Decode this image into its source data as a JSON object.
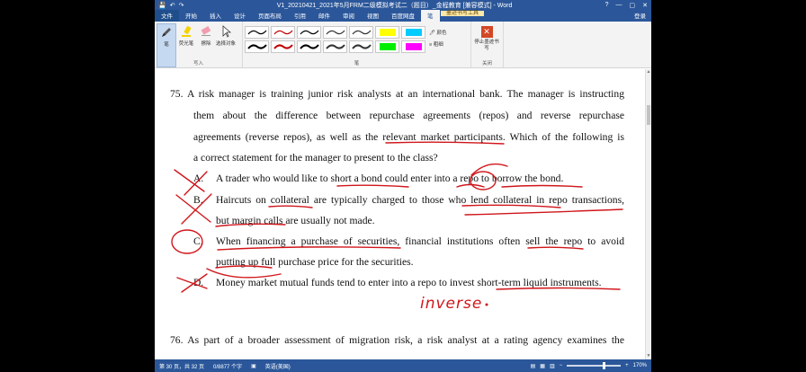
{
  "window": {
    "title": "V1_20210421_2021年5月FRM二级模拟考试二（题目）_金程教育 [兼容模式] - Word",
    "quick_access": [
      "💾",
      "↶",
      "↷"
    ],
    "controls": [
      "?",
      "—",
      "▢",
      "✕"
    ]
  },
  "tabs": {
    "items": [
      "文件",
      "开始",
      "插入",
      "设计",
      "页面布局",
      "引用",
      "邮件",
      "审阅",
      "视图",
      "百度网盘",
      "笔"
    ],
    "contextual_label": "墨迹书写工具",
    "login": "登录"
  },
  "ribbon": {
    "tools": [
      {
        "label": "笔",
        "icon": "pen-icon"
      },
      {
        "label": "荧光笔",
        "icon": "highlighter-icon"
      },
      {
        "label": "擦除",
        "icon": "eraser-icon"
      },
      {
        "label": "选择对象",
        "icon": "select-cursor-icon"
      }
    ],
    "group_write": "写入",
    "group_pens": "笔",
    "pen_colors": [
      "#000000",
      "#c00000",
      "#000000",
      "#000000",
      "#000000",
      "#ffff00",
      "#00ccff",
      "#000000",
      "#c00000",
      "#000000",
      "#000000",
      "#000000",
      "#00ee00",
      "#ff00ff"
    ],
    "color_label": "颜色",
    "thickness_label": "粗细",
    "stop_label": "停止墨迹书写",
    "group_close": "关闭"
  },
  "document": {
    "q75_lines": [
      "75.  A risk manager is training junior risk analysts at an international bank. The manager is instructing",
      "them about the difference between repurchase agreements (repos) and reverse repurchase",
      "agreements (reverse repos), as well as the relevant market participants. Which of the following is",
      "a correct statement for the manager to present to the class?"
    ],
    "options": [
      {
        "letter": "A.",
        "lines": [
          "A trader who would like to short a bond could enter into a repo to borrow the bond."
        ]
      },
      {
        "letter": "B.",
        "lines": [
          "Haircuts on collateral are typically charged to those who lend collateral in repo transactions,",
          "but margin calls are usually not made."
        ]
      },
      {
        "letter": "C.",
        "lines": [
          "When financing a purchase of securities, financial institutions often sell the repo to avoid",
          "putting up full purchase price for the securities."
        ]
      },
      {
        "letter": "D.",
        "lines": [
          "Money market mutual funds tend to enter into a repo to invest short-term liquid instruments."
        ]
      }
    ],
    "handwritten_note": "inverse",
    "q76_line": "76.  As part of a broader assessment of migration risk, a risk analyst at a rating agency examines the",
    "ink_color": "#d0161b"
  },
  "status": {
    "page": "第 30 页，共 32 页",
    "words": "0/8877 个字",
    "language": "英语(美国)",
    "zoom": "170%"
  }
}
